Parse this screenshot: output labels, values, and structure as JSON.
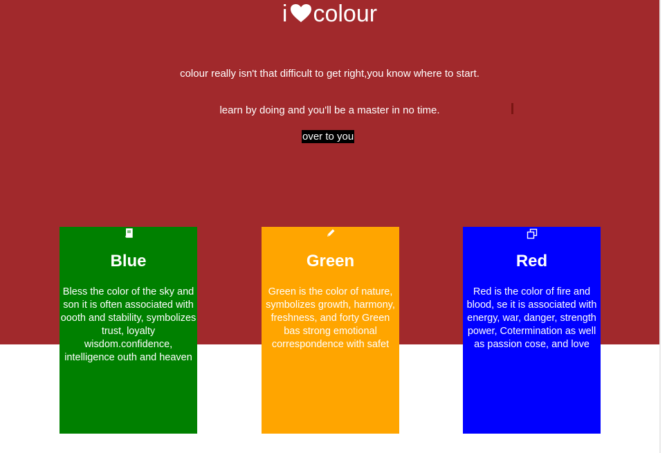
{
  "header": {
    "brand_prefix": "i",
    "brand_suffix": "colour"
  },
  "hero": {
    "tagline_1": "colour really isn't that difficult to get right,you know where to start.",
    "tagline_2": "learn by doing and you'll be a master in no time.",
    "cta_label": "over to you",
    "background_color": "#a1292c"
  },
  "cards": [
    {
      "icon": "book-icon",
      "title": "Blue",
      "text": "Bless the color of the sky and son it is often associated with oooth and stability, symbolizes trust, loyalty wisdom.confidence, intelligence outh and heaven",
      "color": "#008000"
    },
    {
      "icon": "pencil-icon",
      "title": "Green",
      "text": "Green is the color of nature, symbolizes growth, harmony, freshness, and forty Green bas strong emotional correspondence with safet",
      "color": "#ffa500"
    },
    {
      "icon": "copy-icon",
      "title": "Red",
      "text": "Red is the color of fire and blood, se it is associated with energy, war, danger, strength power, Cotermination as well as passion cose, and love",
      "color": "#0000ff"
    }
  ]
}
